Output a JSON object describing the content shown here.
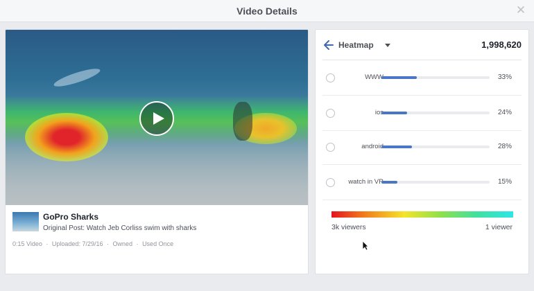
{
  "dialog": {
    "title": "Video Details",
    "close_icon": "close-icon"
  },
  "video": {
    "play_icon": "play-icon",
    "title": "GoPro Sharks",
    "subtitle": "Original Post: Watch Jeb Corliss swim with sharks",
    "meta": {
      "duration": "0:15 Video",
      "uploaded": "Uploaded: 7/29/16",
      "owned": "Owned",
      "used": "Used Once",
      "separator": "·"
    }
  },
  "heatmap": {
    "label": "Heatmap",
    "back_icon": "back-arrow-icon",
    "caret_icon": "caret-down-icon",
    "total": "1,998,620",
    "rows": [
      {
        "label": "WWW",
        "percent": "33%",
        "fraction": 0.33
      },
      {
        "label": "ios",
        "percent": "24%",
        "fraction": 0.24
      },
      {
        "label": "android",
        "percent": "28%",
        "fraction": 0.28
      },
      {
        "label": "watch in VR",
        "percent": "15%",
        "fraction": 0.15
      }
    ],
    "legend": {
      "left": "3k viewers",
      "right": "1 viewer"
    }
  },
  "colors": {
    "bar_fill": "#4a76c8",
    "bar_track": "#e9ebee",
    "gradient": [
      "#e6141f",
      "#f27c1d",
      "#f4e42b",
      "#8fe04a",
      "#3fe0a0",
      "#2ee6e6"
    ]
  }
}
